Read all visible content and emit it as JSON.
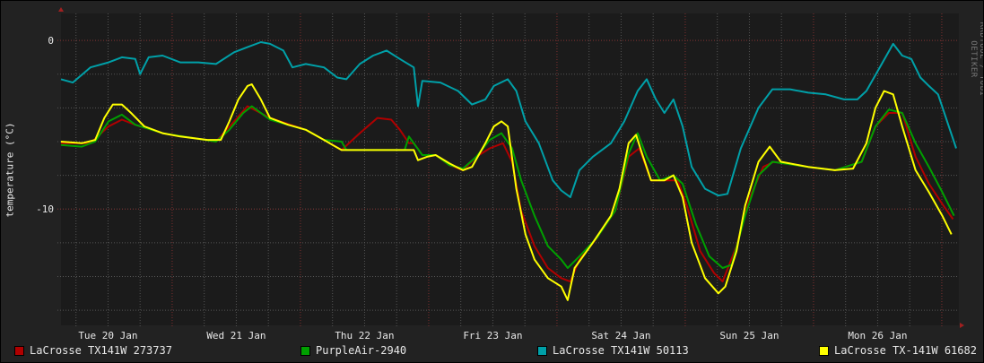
{
  "watermark": "RRDTOOL / TOBI OETIKER",
  "chart_data": {
    "type": "line",
    "title": "",
    "xlabel": "",
    "ylabel": "temperature (°C)",
    "x_units": "hours since start of window",
    "xlim": [
      0,
      168
    ],
    "ylim": [
      -16.9,
      1.6
    ],
    "grid": true,
    "y_major_ticks": [
      {
        "value": 0,
        "label": "0"
      },
      {
        "value": -10,
        "label": "-10"
      }
    ],
    "y_minor_ticks": [
      0,
      -2,
      -4,
      -6,
      -8,
      -10,
      -12,
      -14,
      -16
    ],
    "x_day_ticks": [
      {
        "hour": 8.8,
        "label": "Tue 20 Jan"
      },
      {
        "hour": 32.8,
        "label": "Wed 21 Jan"
      },
      {
        "hour": 56.8,
        "label": "Thu 22 Jan"
      },
      {
        "hour": 80.8,
        "label": "Fri 23 Jan"
      },
      {
        "hour": 104.8,
        "label": "Sat 24 Jan"
      },
      {
        "hour": 128.8,
        "label": "Sun 25 Jan"
      },
      {
        "hour": 152.8,
        "label": "Mon 26 Jan"
      }
    ],
    "x_major_grid_hours": [
      20.8,
      44.8,
      68.8,
      92.8,
      116.8,
      140.8,
      164.8
    ],
    "x_minor_grid_step_hours": 6,
    "x_minor_grid_start_hour": 2.8,
    "legend_placement": "bottom",
    "series": [
      {
        "name": "LaCrosse TX141W 273737",
        "color": "#b00000",
        "points": [
          [
            0,
            -6.1
          ],
          [
            5.5,
            -6.1
          ],
          [
            8.9,
            -5.1
          ],
          [
            11.4,
            -4.7
          ],
          [
            13.9,
            -5.0
          ],
          [
            19,
            -5.5
          ],
          [
            29,
            -6.0
          ],
          [
            32.4,
            -4.8
          ],
          [
            34.9,
            -3.9
          ],
          [
            39.1,
            -4.6
          ],
          [
            45.8,
            -5.3
          ],
          [
            49.2,
            -5.9
          ],
          [
            52.5,
            -6.5
          ],
          [
            55.9,
            -5.5
          ],
          [
            59.2,
            -4.6
          ],
          [
            61.8,
            -4.7
          ],
          [
            63.4,
            -5.3
          ],
          [
            65.1,
            -6.1
          ],
          [
            66,
            -6.1
          ],
          [
            67.6,
            -6.8
          ],
          [
            70.1,
            -6.8
          ],
          [
            72.7,
            -7.4
          ],
          [
            75.2,
            -7.7
          ],
          [
            77.7,
            -6.9
          ],
          [
            80.2,
            -6.4
          ],
          [
            82.7,
            -6.1
          ],
          [
            84.4,
            -7.2
          ],
          [
            86.1,
            -10.1
          ],
          [
            88.6,
            -12.2
          ],
          [
            91.1,
            -13.5
          ],
          [
            93.6,
            -14.1
          ],
          [
            95.3,
            -14.3
          ],
          [
            97,
            -13.0
          ],
          [
            100.3,
            -11.7
          ],
          [
            103.7,
            -10.1
          ],
          [
            106.2,
            -6.9
          ],
          [
            108.2,
            -6.4
          ],
          [
            110.4,
            -8.3
          ],
          [
            112.9,
            -8.3
          ],
          [
            115.4,
            -8.3
          ],
          [
            117.1,
            -9.8
          ],
          [
            119.6,
            -12.5
          ],
          [
            122.2,
            -13.8
          ],
          [
            123.8,
            -14.3
          ],
          [
            126.4,
            -12.2
          ],
          [
            128.9,
            -9.3
          ],
          [
            131.4,
            -7.5
          ],
          [
            133.4,
            -7.2
          ],
          [
            139.8,
            -7.5
          ],
          [
            144.8,
            -7.7
          ],
          [
            149.8,
            -7.2
          ],
          [
            152.4,
            -5.1
          ],
          [
            154.9,
            -4.3
          ],
          [
            157.4,
            -4.3
          ],
          [
            159.9,
            -6.9
          ],
          [
            162.4,
            -8.5
          ],
          [
            164.9,
            -9.7
          ],
          [
            166.9,
            -10.6
          ]
        ]
      },
      {
        "name": "PurpleAir-2940",
        "color": "#00a000",
        "points": [
          [
            0,
            -6.2
          ],
          [
            3.9,
            -6.3
          ],
          [
            6.4,
            -6.0
          ],
          [
            8.9,
            -4.8
          ],
          [
            11.4,
            -4.4
          ],
          [
            13.9,
            -5.0
          ],
          [
            19,
            -5.5
          ],
          [
            29,
            -6.0
          ],
          [
            31.5,
            -5.3
          ],
          [
            34.1,
            -4.3
          ],
          [
            35.7,
            -3.9
          ],
          [
            39.1,
            -4.7
          ],
          [
            45.8,
            -5.3
          ],
          [
            49.2,
            -5.9
          ],
          [
            52.5,
            -6.0
          ],
          [
            53.4,
            -6.5
          ],
          [
            64.3,
            -6.5
          ],
          [
            65.1,
            -5.7
          ],
          [
            67.6,
            -6.8
          ],
          [
            70.1,
            -6.8
          ],
          [
            72.7,
            -7.4
          ],
          [
            75.2,
            -7.6
          ],
          [
            77.7,
            -6.9
          ],
          [
            80.2,
            -5.9
          ],
          [
            82.4,
            -5.5
          ],
          [
            84.4,
            -6.4
          ],
          [
            86.1,
            -8.3
          ],
          [
            88.6,
            -10.4
          ],
          [
            91.1,
            -12.2
          ],
          [
            93.6,
            -13.0
          ],
          [
            94.8,
            -13.5
          ],
          [
            97,
            -12.8
          ],
          [
            100.3,
            -11.7
          ],
          [
            103.7,
            -10.1
          ],
          [
            106.2,
            -6.7
          ],
          [
            107.9,
            -5.5
          ],
          [
            109.6,
            -6.9
          ],
          [
            112.1,
            -8.3
          ],
          [
            114.6,
            -8.0
          ],
          [
            116.3,
            -8.5
          ],
          [
            118.8,
            -10.9
          ],
          [
            121.3,
            -12.8
          ],
          [
            123.8,
            -13.5
          ],
          [
            125.5,
            -13.3
          ],
          [
            128,
            -10.4
          ],
          [
            130.5,
            -8.0
          ],
          [
            133.1,
            -7.2
          ],
          [
            139.8,
            -7.5
          ],
          [
            144.8,
            -7.7
          ],
          [
            149.8,
            -7.2
          ],
          [
            152.4,
            -5.1
          ],
          [
            154.9,
            -4.1
          ],
          [
            157.4,
            -4.3
          ],
          [
            159.9,
            -6.1
          ],
          [
            162.4,
            -7.5
          ],
          [
            164.9,
            -9.0
          ],
          [
            167.1,
            -10.4
          ]
        ]
      },
      {
        "name": "LaCrosse TX141W 50113",
        "color": "#00a0a8",
        "points": [
          [
            0,
            -2.3
          ],
          [
            2.2,
            -2.5
          ],
          [
            5.5,
            -1.6
          ],
          [
            8.9,
            -1.3
          ],
          [
            11.4,
            -1.0
          ],
          [
            13.9,
            -1.1
          ],
          [
            14.8,
            -2.0
          ],
          [
            16.4,
            -1.0
          ],
          [
            19,
            -0.9
          ],
          [
            22.3,
            -1.3
          ],
          [
            25.7,
            -1.3
          ],
          [
            29,
            -1.4
          ],
          [
            32.4,
            -0.7
          ],
          [
            34.9,
            -0.4
          ],
          [
            37.4,
            -0.1
          ],
          [
            39.1,
            -0.2
          ],
          [
            41.6,
            -0.6
          ],
          [
            43.3,
            -1.6
          ],
          [
            45.8,
            -1.4
          ],
          [
            49.2,
            -1.6
          ],
          [
            51.7,
            -2.2
          ],
          [
            53.4,
            -2.3
          ],
          [
            55.9,
            -1.4
          ],
          [
            58.4,
            -0.9
          ],
          [
            60.9,
            -0.6
          ],
          [
            63.4,
            -1.1
          ],
          [
            66,
            -1.6
          ],
          [
            66.8,
            -3.9
          ],
          [
            67.6,
            -2.4
          ],
          [
            71,
            -2.5
          ],
          [
            74.3,
            -3.0
          ],
          [
            76.9,
            -3.8
          ],
          [
            79.4,
            -3.5
          ],
          [
            81,
            -2.7
          ],
          [
            83.6,
            -2.3
          ],
          [
            85.2,
            -3.0
          ],
          [
            86.9,
            -4.8
          ],
          [
            89.4,
            -6.1
          ],
          [
            92,
            -8.3
          ],
          [
            93.6,
            -8.9
          ],
          [
            95.3,
            -9.3
          ],
          [
            97,
            -7.7
          ],
          [
            99.5,
            -6.9
          ],
          [
            102.9,
            -6.1
          ],
          [
            105.4,
            -4.8
          ],
          [
            107.9,
            -3.0
          ],
          [
            109.6,
            -2.3
          ],
          [
            111.3,
            -3.5
          ],
          [
            112.9,
            -4.3
          ],
          [
            114.6,
            -3.5
          ],
          [
            116.3,
            -5.1
          ],
          [
            118,
            -7.5
          ],
          [
            120.5,
            -8.8
          ],
          [
            123,
            -9.2
          ],
          [
            124.7,
            -9.1
          ],
          [
            127.2,
            -6.4
          ],
          [
            130.5,
            -4.0
          ],
          [
            133.1,
            -2.9
          ],
          [
            136.4,
            -2.9
          ],
          [
            139.8,
            -3.1
          ],
          [
            143.1,
            -3.2
          ],
          [
            146.5,
            -3.5
          ],
          [
            149,
            -3.5
          ],
          [
            150.7,
            -3.0
          ],
          [
            153.2,
            -1.6
          ],
          [
            155.7,
            -0.2
          ],
          [
            157.4,
            -0.9
          ],
          [
            159.1,
            -1.1
          ],
          [
            160.8,
            -2.2
          ],
          [
            162.4,
            -2.7
          ],
          [
            164.1,
            -3.2
          ],
          [
            165.8,
            -4.8
          ],
          [
            167.5,
            -6.4
          ]
        ]
      },
      {
        "name": "LaCrosse TX-141W 61682",
        "color": "#ffff00",
        "points": [
          [
            0,
            -6.0
          ],
          [
            3.9,
            -6.1
          ],
          [
            6.4,
            -5.9
          ],
          [
            8.1,
            -4.6
          ],
          [
            9.7,
            -3.8
          ],
          [
            11.4,
            -3.8
          ],
          [
            13.1,
            -4.3
          ],
          [
            15.6,
            -5.1
          ],
          [
            19,
            -5.5
          ],
          [
            22.3,
            -5.7
          ],
          [
            27.4,
            -5.9
          ],
          [
            29.9,
            -5.9
          ],
          [
            31.5,
            -4.8
          ],
          [
            33.2,
            -3.5
          ],
          [
            34.9,
            -2.7
          ],
          [
            35.7,
            -2.6
          ],
          [
            37.4,
            -3.5
          ],
          [
            39.1,
            -4.6
          ],
          [
            42.5,
            -5.0
          ],
          [
            45.8,
            -5.3
          ],
          [
            49.2,
            -5.9
          ],
          [
            50.8,
            -6.2
          ],
          [
            52.5,
            -6.5
          ],
          [
            66,
            -6.5
          ],
          [
            66.8,
            -7.1
          ],
          [
            68.5,
            -6.9
          ],
          [
            70.1,
            -6.8
          ],
          [
            72.7,
            -7.3
          ],
          [
            75.2,
            -7.7
          ],
          [
            76.9,
            -7.5
          ],
          [
            79.4,
            -6.1
          ],
          [
            81,
            -5.1
          ],
          [
            82.4,
            -4.8
          ],
          [
            83.6,
            -5.1
          ],
          [
            85.2,
            -8.8
          ],
          [
            86.9,
            -11.5
          ],
          [
            88.6,
            -13.0
          ],
          [
            91.1,
            -14.1
          ],
          [
            93.6,
            -14.6
          ],
          [
            94.8,
            -15.4
          ],
          [
            96.1,
            -13.5
          ],
          [
            99.5,
            -12.0
          ],
          [
            102.9,
            -10.4
          ],
          [
            104.5,
            -8.8
          ],
          [
            106.2,
            -6.1
          ],
          [
            107.6,
            -5.6
          ],
          [
            108.7,
            -6.7
          ],
          [
            110.4,
            -8.3
          ],
          [
            112.9,
            -8.3
          ],
          [
            114.6,
            -8.0
          ],
          [
            116.3,
            -9.3
          ],
          [
            118,
            -12.0
          ],
          [
            120.5,
            -14.1
          ],
          [
            123,
            -15.0
          ],
          [
            124.3,
            -14.6
          ],
          [
            126.4,
            -12.5
          ],
          [
            128,
            -9.8
          ],
          [
            130.5,
            -7.2
          ],
          [
            132.6,
            -6.3
          ],
          [
            134.7,
            -7.2
          ],
          [
            139.8,
            -7.5
          ],
          [
            144.8,
            -7.7
          ],
          [
            148.2,
            -7.6
          ],
          [
            150.7,
            -6.1
          ],
          [
            152.4,
            -4.0
          ],
          [
            154,
            -3.0
          ],
          [
            155.7,
            -3.2
          ],
          [
            157.4,
            -5.1
          ],
          [
            159.9,
            -7.7
          ],
          [
            162.4,
            -9.0
          ],
          [
            164.9,
            -10.4
          ],
          [
            166.6,
            -11.5
          ]
        ]
      }
    ]
  }
}
